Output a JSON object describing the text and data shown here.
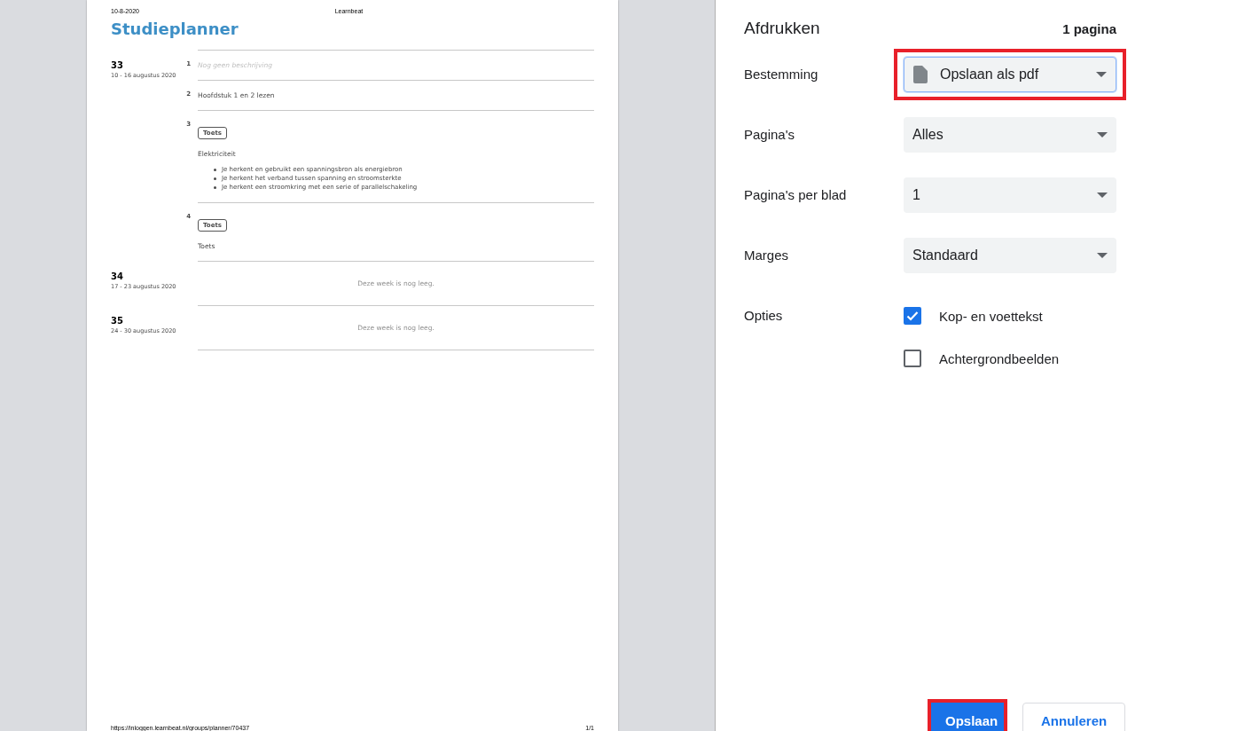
{
  "preview": {
    "header_date": "10-8-2020",
    "header_site": "Learnbeat",
    "title": "Studieplanner",
    "weeks": [
      {
        "number": "33",
        "dates": "10 - 16 augustus 2020",
        "items": [
          {
            "index": "1",
            "kind": "placeholder",
            "text": "Nog geen beschrijving"
          },
          {
            "index": "2",
            "kind": "text",
            "text": "Hoofdstuk 1 en 2 lezen"
          },
          {
            "index": "3",
            "kind": "test",
            "badge": "Toets",
            "text": "Elektriciteit",
            "bullets": [
              "Je herkent en gebruikt een spanningsbron als energiebron",
              "Je herkent het verband tussen spanning en stroomsterkte",
              "Je herkent een stroomkring met een serie of parallelschakeling"
            ]
          },
          {
            "index": "4",
            "kind": "test",
            "badge": "Toets",
            "text": "Toets"
          }
        ]
      },
      {
        "number": "34",
        "dates": "17 - 23 augustus 2020",
        "empty": "Deze week is nog leeg."
      },
      {
        "number": "35",
        "dates": "24 - 30 augustus 2020",
        "empty": "Deze week is nog leeg."
      }
    ],
    "footer_url": "https://inloggen.learnbeat.nl/groups/planner/70437",
    "footer_page": "1/1"
  },
  "panel": {
    "title": "Afdrukken",
    "page_count": "1 pagina",
    "settings": [
      {
        "label": "Bestemming",
        "kind": "dropdown",
        "value": "Opslaan als pdf",
        "icon": true,
        "highlighted": true
      },
      {
        "label": "Pagina's",
        "kind": "dropdown",
        "value": "Alles",
        "highlighted": false
      },
      {
        "label": "Pagina's per blad",
        "kind": "dropdown",
        "value": "1",
        "highlighted": false
      },
      {
        "label": "Marges",
        "kind": "dropdown",
        "value": "Standaard",
        "highlighted": false
      },
      {
        "label": "Opties",
        "kind": "checks",
        "options": [
          {
            "label": "Kop- en voettekst",
            "checked": true
          },
          {
            "label": "Achtergrondbeelden",
            "checked": false
          }
        ]
      }
    ],
    "buttons": [
      {
        "label": "Opslaan",
        "kind": "primary",
        "highlighted": true
      },
      {
        "label": "Annuleren",
        "kind": "secondary",
        "highlighted": false
      }
    ]
  }
}
